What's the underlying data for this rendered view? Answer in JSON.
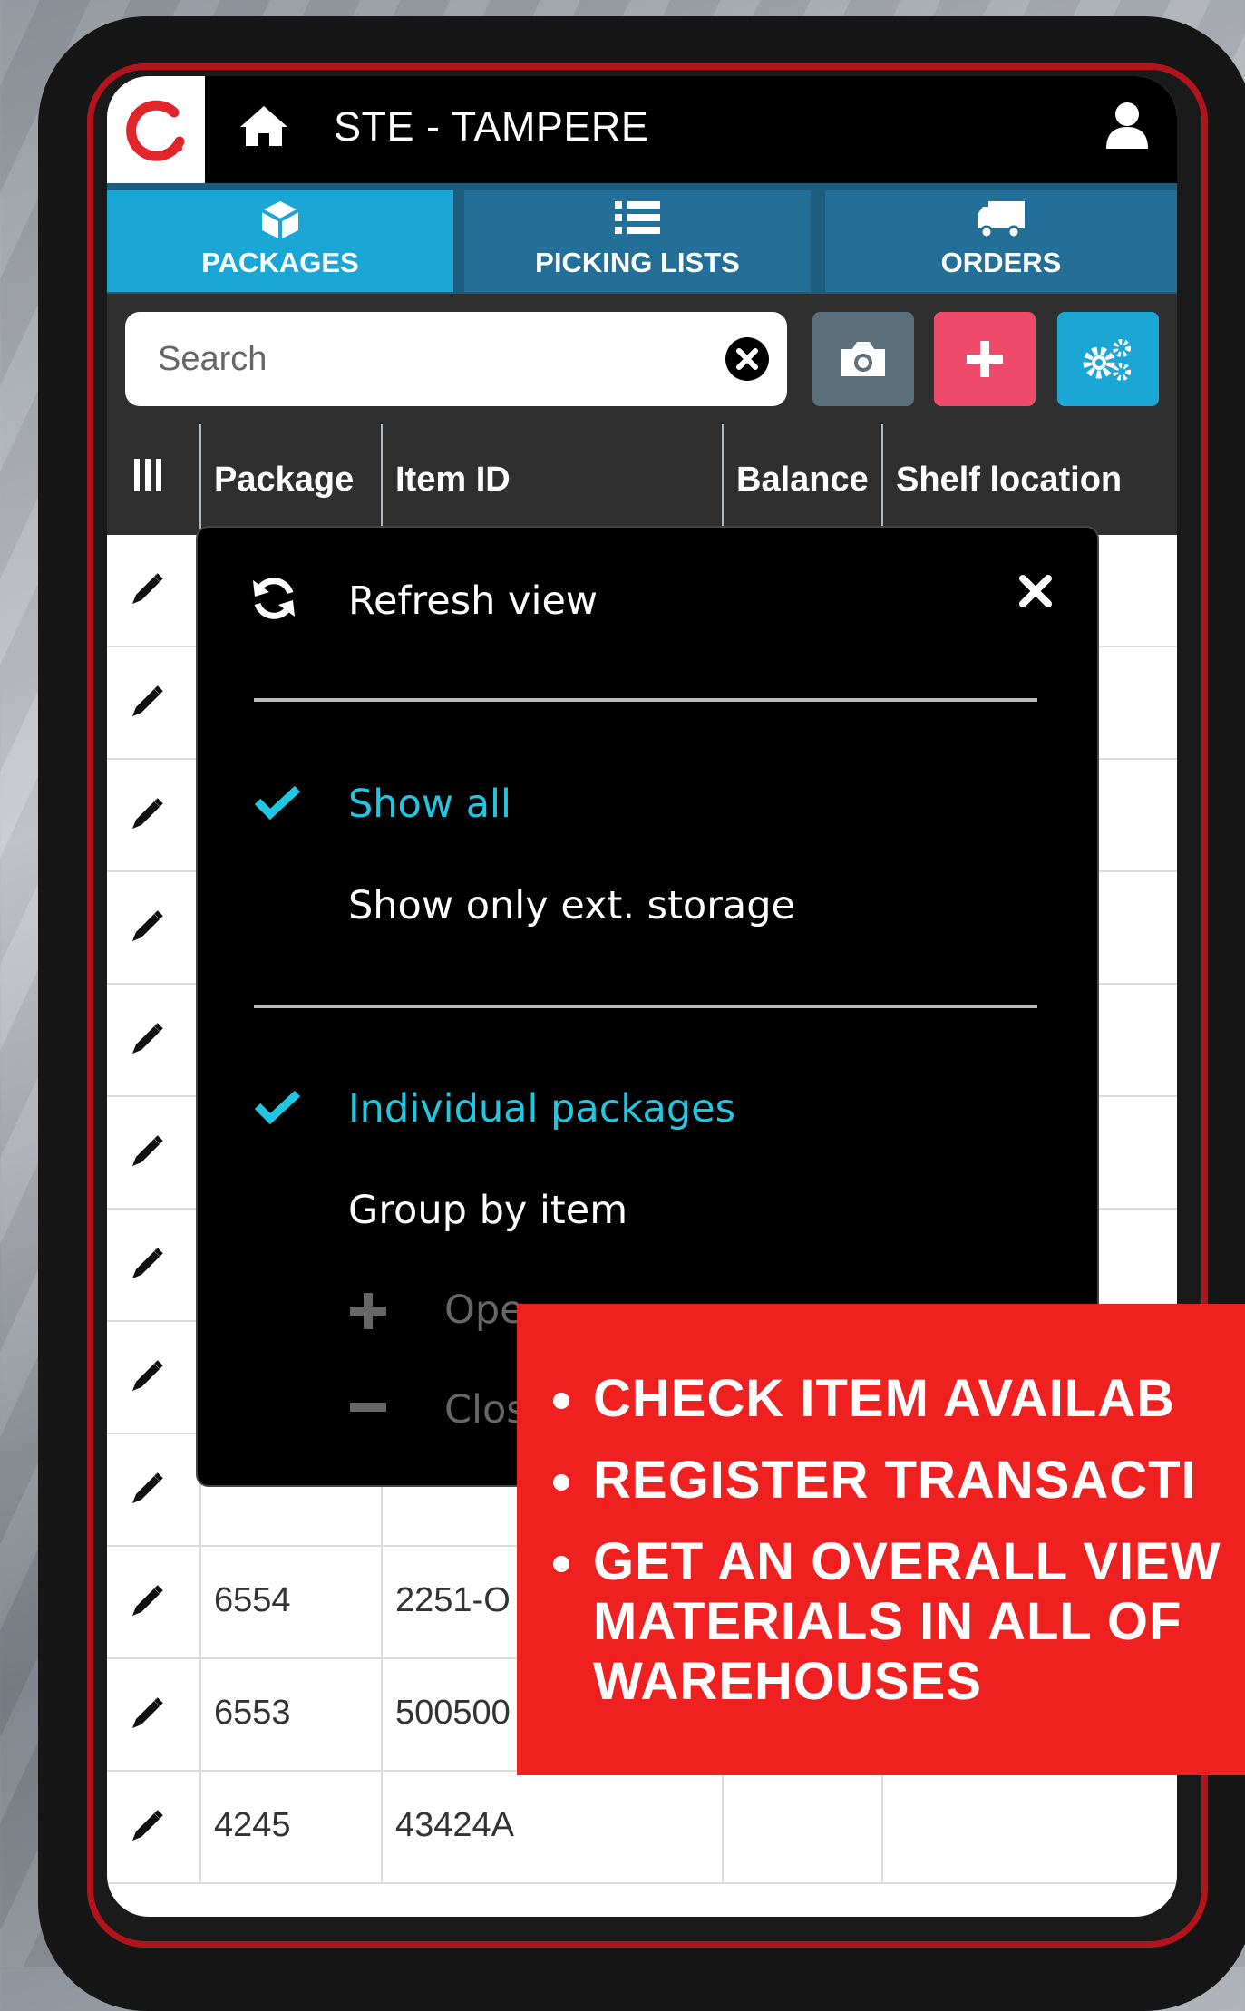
{
  "header": {
    "title": "STE - TAMPERE"
  },
  "tabs": [
    {
      "label": "PACKAGES",
      "icon": "cube-icon",
      "active": true
    },
    {
      "label": "PICKING LISTS",
      "icon": "list-icon",
      "active": false
    },
    {
      "label": "ORDERS",
      "icon": "truck-icon",
      "active": false
    }
  ],
  "search": {
    "placeholder": "Search",
    "value": ""
  },
  "toolbar": {
    "camera": "camera-icon",
    "add": "plus-icon",
    "settings": "cogs-icon"
  },
  "table": {
    "columns": [
      "Package",
      "Item ID",
      "Balance",
      "Shelf location"
    ],
    "rows": [
      {
        "package": "6554",
        "item_id": "2251-O"
      },
      {
        "package": "6553",
        "item_id": "500500"
      },
      {
        "package": "4245",
        "item_id": "43424A"
      }
    ]
  },
  "menu": {
    "refresh": "Refresh view",
    "show_all": "Show all",
    "show_ext": "Show only ext. storage",
    "individual": "Individual packages",
    "group": "Group by item",
    "open_all": "Ope",
    "close_all": "Clos"
  },
  "promo": {
    "line1": "CHECK ITEM AVAILAB",
    "line2": "REGISTER TRANSACTI",
    "line3": "GET AN OVERALL VIEW\nMATERIALS IN ALL OF\nWAREHOUSES"
  },
  "colors": {
    "accent": "#1ba7d6",
    "tab": "#236f97",
    "add": "#ee4b6b",
    "selected": "#23c6e0",
    "promo": "#ee2020"
  }
}
